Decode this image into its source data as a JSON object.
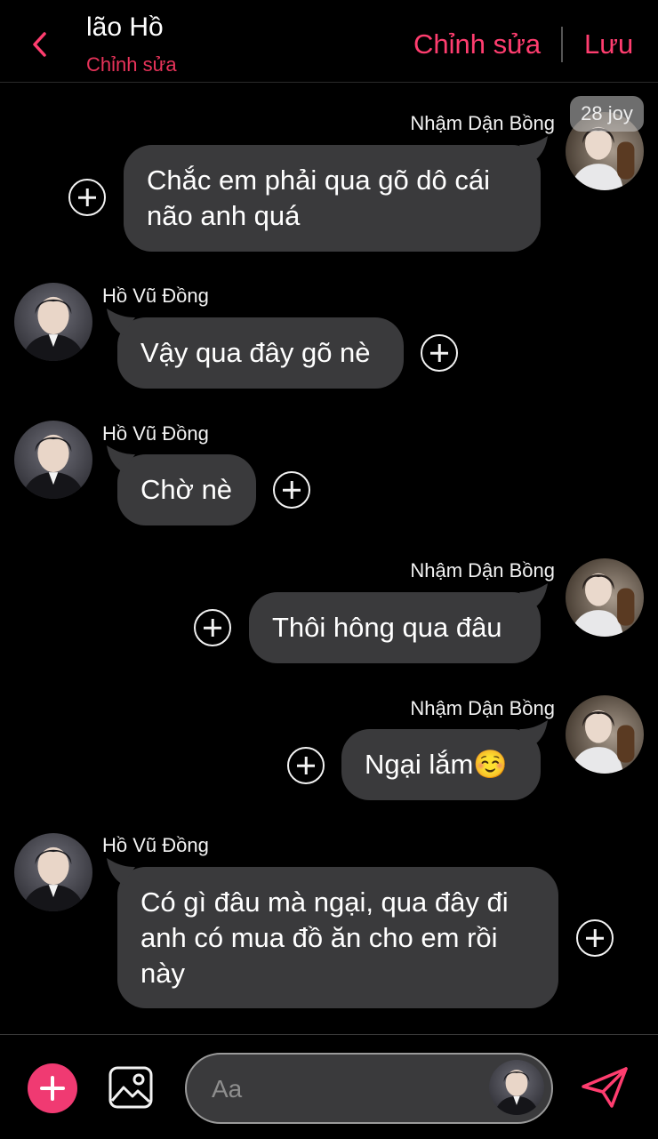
{
  "header": {
    "title": "lão Hồ",
    "subtitle": "Chỉnh sửa",
    "edit_label": "Chỉnh sửa",
    "save_label": "Lưu"
  },
  "time_badge": "28 joy",
  "messages": [
    {
      "sender": "Nhậm Dận Bồng",
      "side": "right",
      "lines": [
        "Chắc em phải qua gõ dô cái",
        "não anh quá"
      ]
    },
    {
      "sender": "Hồ Vũ Đồng",
      "side": "left",
      "lines": [
        "Vậy qua đây gõ nè"
      ]
    },
    {
      "sender": "Hồ Vũ Đồng",
      "side": "left",
      "lines": [
        "Chờ nè"
      ]
    },
    {
      "sender": "Nhậm Dận Bồng",
      "side": "right",
      "lines": [
        "Thôi hông qua đâu"
      ]
    },
    {
      "sender": "Nhậm Dận Bồng",
      "side": "right",
      "lines": [
        "Ngại lắm☺️"
      ]
    },
    {
      "sender": "Hồ Vũ Đồng",
      "side": "left",
      "lines": [
        "Có gì đâu mà ngại, qua đây đi",
        "anh có mua đồ ăn cho em rồi",
        "này"
      ]
    }
  ],
  "composer": {
    "placeholder": "Aa"
  },
  "colors": {
    "accent": "#ff3d6f",
    "bubble": "#3a3a3c",
    "background": "#000000"
  },
  "icons": [
    "chevron-left-icon",
    "plus-circle-icon",
    "add-icon",
    "image-icon",
    "send-icon"
  ]
}
